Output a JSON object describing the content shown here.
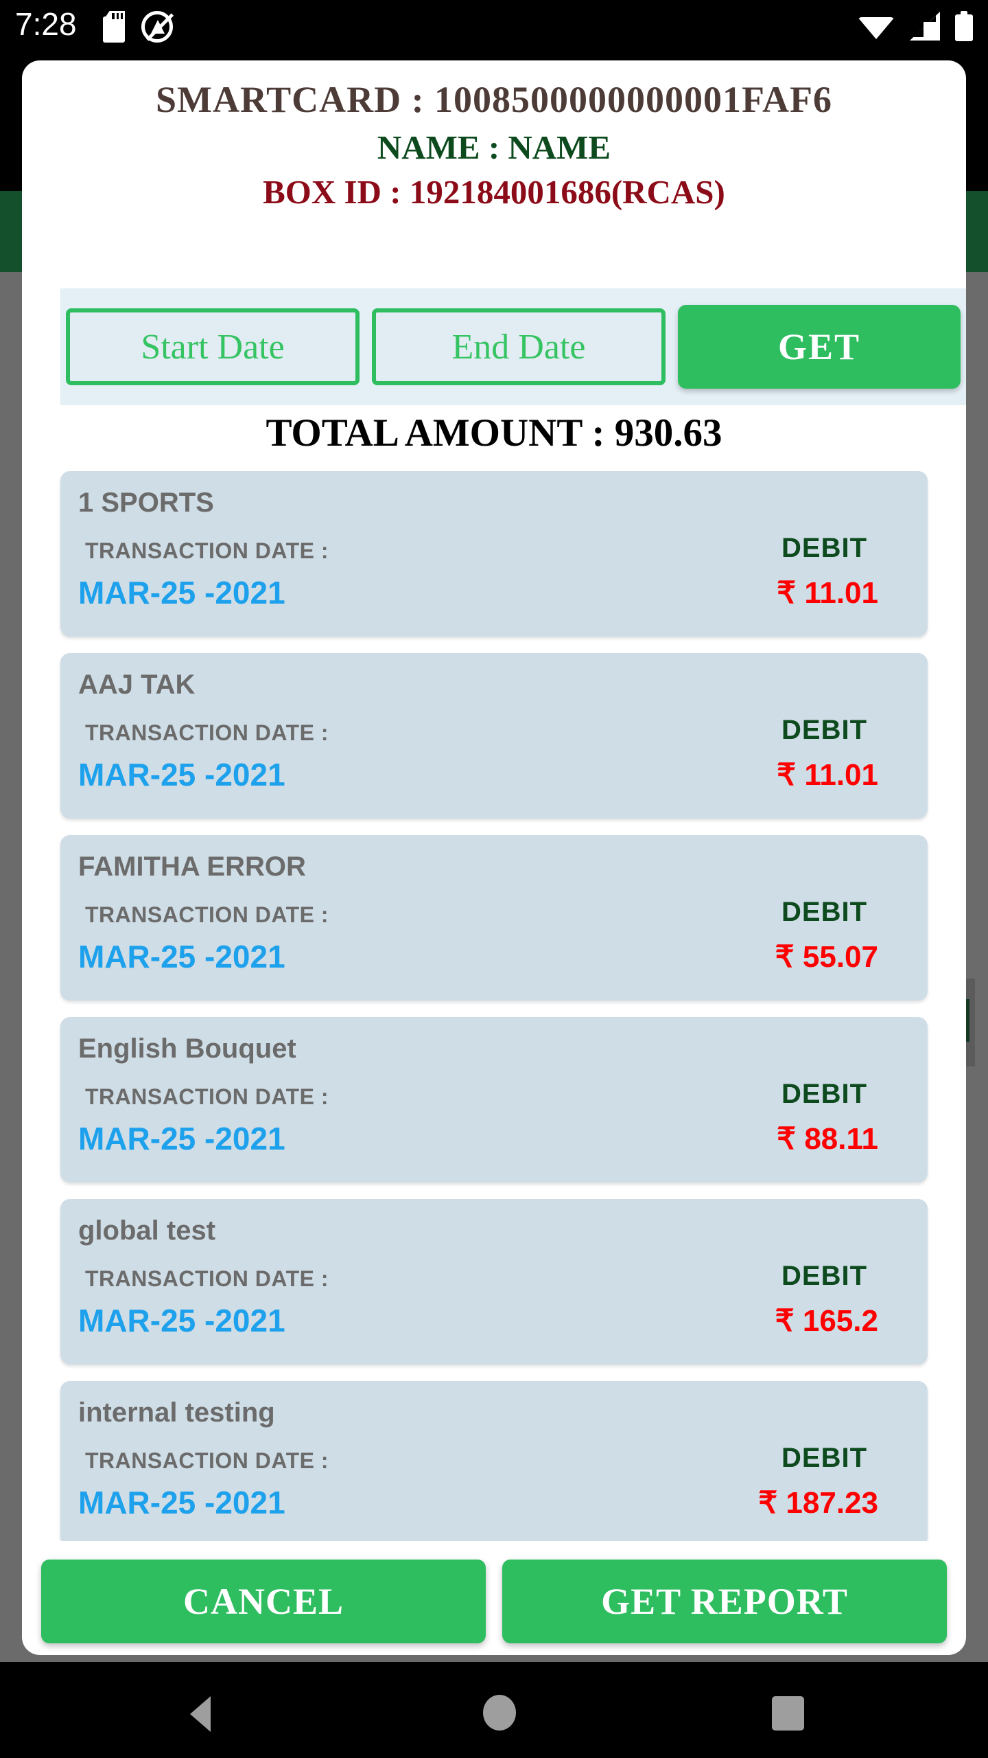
{
  "status_bar": {
    "clock": "7:28",
    "left_icons": [
      "sdcard-icon",
      "no-sim-icon"
    ],
    "right_icons": [
      "wifi-icon",
      "signal-icon",
      "battery-icon"
    ]
  },
  "dialog": {
    "header": {
      "smartcard": "SMARTCARD :  1008500000000001FAF6",
      "name": "NAME :  NAME",
      "box_id": "BOX ID :  192184001686(RCAS)"
    },
    "filter": {
      "start_date_placeholder": "Start Date",
      "end_date_placeholder": "End Date",
      "get_label": "GET"
    },
    "total": "TOTAL AMOUNT :  930.63",
    "transactions": [
      {
        "title": "1 SPORTS",
        "date_label": "TRANSACTION DATE :",
        "date": "MAR-25 -2021",
        "type": "DEBIT",
        "amount": "₹ 11.01"
      },
      {
        "title": "AAJ TAK",
        "date_label": "TRANSACTION DATE :",
        "date": "MAR-25 -2021",
        "type": "DEBIT",
        "amount": "₹ 11.01"
      },
      {
        "title": "FAMITHA ERROR",
        "date_label": "TRANSACTION DATE :",
        "date": "MAR-25 -2021",
        "type": "DEBIT",
        "amount": "₹ 55.07"
      },
      {
        "title": "English Bouquet",
        "date_label": "TRANSACTION DATE :",
        "date": "MAR-25 -2021",
        "type": "DEBIT",
        "amount": "₹ 88.11"
      },
      {
        "title": "global test",
        "date_label": "TRANSACTION DATE :",
        "date": "MAR-25 -2021",
        "type": "DEBIT",
        "amount": "₹ 165.2"
      },
      {
        "title": "internal testing",
        "date_label": "TRANSACTION DATE :",
        "date": "MAR-25 -2021",
        "type": "DEBIT",
        "amount": "₹ 187.23"
      }
    ],
    "footer": {
      "cancel_label": "CANCEL",
      "get_report_label": "GET REPORT"
    }
  },
  "nav_bar": {
    "back": "back-icon",
    "home": "home-icon",
    "recents": "recents-icon"
  },
  "colors": {
    "accent_green": "#2ebd5f",
    "appbar_green": "#14502b",
    "card_blue": "#cfdde6",
    "date_blue": "#1ea1ec",
    "amount_red": "#ff0000",
    "debit_green": "#0d4a1e",
    "boxid_red": "#8c0b18"
  }
}
